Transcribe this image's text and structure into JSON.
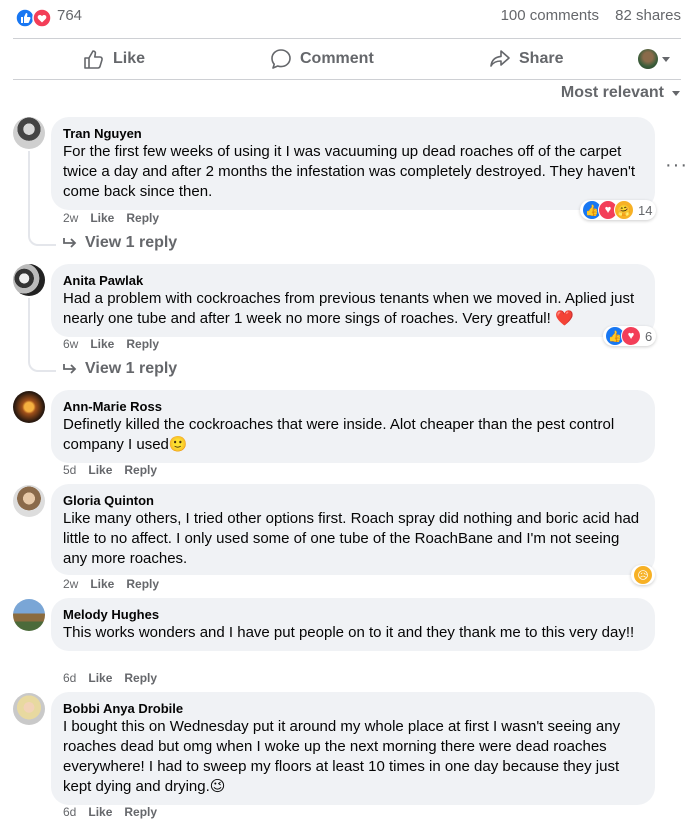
{
  "header": {
    "reaction_count": "764",
    "comments_text": "100 comments",
    "shares_text": "82 shares",
    "reaction_icons": [
      "like-icon",
      "love-icon"
    ],
    "colors": {
      "like": "#1877f2",
      "love": "#f33e58",
      "muted": "#65676b",
      "bubble": "#f0f2f5"
    }
  },
  "actions": {
    "like": "Like",
    "comment": "Comment",
    "share": "Share"
  },
  "sort_label": "Most relevant",
  "comments": [
    {
      "name": "Tran Nguyen",
      "text": "For the first few weeks of using it I was vacuuming up dead roaches off of the carpet twice a day and after 2 months the infestation was completely destroyed. They haven't come back since then.",
      "time": "2w",
      "like": "Like",
      "reply": "Reply",
      "reactions": {
        "icons": [
          "like-icon",
          "love-icon",
          "care-icon"
        ],
        "count": "14"
      },
      "view_replies": "View 1 reply"
    },
    {
      "name": "Anita Pawlak",
      "text": "Had a problem with cockroaches from previous tenants when we moved in. Aplied just nearly one tube and after 1 week no more sings of roaches. Very greatful! ❤️",
      "time": "6w",
      "like": "Like",
      "reply": "Reply",
      "reactions": {
        "icons": [
          "like-icon",
          "love-icon"
        ],
        "count": "6"
      },
      "view_replies": "View 1 reply"
    },
    {
      "name": "Ann-Marie Ross",
      "text": "Definetly killed the cockroaches that were inside. Alot cheaper than the pest control company I used🙂",
      "time": "5d",
      "like": "Like",
      "reply": "Reply"
    },
    {
      "name": "Gloria Quinton",
      "text": "Like many others, I tried other options first. Roach spray did nothing and boric acid had little to no affect. I only used some of one tube of the RoachBane and I'm not seeing any more roaches.",
      "time": "2w",
      "like": "Like",
      "reply": "Reply",
      "reactions": {
        "icons": [
          "sad-icon"
        ],
        "count": ""
      }
    },
    {
      "name": "Melody Hughes",
      "text": "This works wonders and I have put people on to it and they thank me to this very day!!",
      "time": "6d",
      "like": "Like",
      "reply": "Reply"
    },
    {
      "name": "Bobbi Anya Drobile",
      "text": "I bought this on Wednesday put it around my whole place at first I wasn't seeing any roaches dead but omg when I woke up the next morning there were dead roaches everywhere! I had to sweep my floors at least 10 times in one day because they just kept dying and drying.😉",
      "time": "6d",
      "like": "Like",
      "reply": "Reply"
    }
  ]
}
